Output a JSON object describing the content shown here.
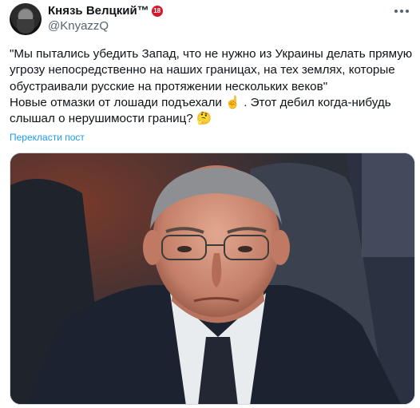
{
  "author": {
    "display_name": "Князь Велцкий™",
    "age_badge": "18",
    "handle": "@KnyazzQ"
  },
  "tweet": {
    "text": "\"Мы пытались убедить Запад, что не нужно из Украины делать прямую угрозу непосредственно на наших границах, на тех землях, которые обустраивали русские на протяжении нескольких веков\"\nНовые отмазки от лошади подъехали",
    "text_tail": ". Этот дебил когда-нибудь слышал о нерушимости границ?",
    "emoji_1": "☝️",
    "emoji_2": "🤔"
  },
  "translate_label": "Перекласти пост",
  "icons": {
    "more": "more-horizontal-icon"
  },
  "colors": {
    "link": "#1d9bf0",
    "secondary_text": "#536471",
    "badge": "#d11b2a"
  }
}
